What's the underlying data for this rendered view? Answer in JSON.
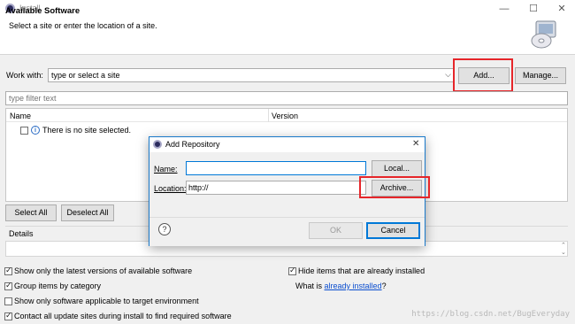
{
  "window": {
    "title": "Install",
    "minimize_glyph": "—",
    "maximize_glyph": "☐",
    "close_glyph": "✕"
  },
  "banner": {
    "title": "Available Software",
    "subtitle": "Select a site or enter the location of a site."
  },
  "work_with": {
    "label": "Work with:",
    "value": "type or select a site",
    "add_label": "Add...",
    "manage_label": "Manage..."
  },
  "filter": {
    "placeholder": "type filter text"
  },
  "tree": {
    "columns": [
      "Name",
      "Version"
    ],
    "message": "There is no site selected."
  },
  "selection": {
    "select_all": "Select All",
    "deselect_all": "Deselect All"
  },
  "details": {
    "label": "Details"
  },
  "options": {
    "latest_versions": "Show only the latest versions of available software",
    "group_by_category": "Group items by category",
    "target_env": "Show only software applicable to target environment",
    "contact_sites": "Contact all update sites during install to find required software",
    "hide_installed": "Hide items that are already installed",
    "what_is_prefix": "What is ",
    "what_is_link": "already installed",
    "what_is_suffix": "?"
  },
  "dialog": {
    "title": "Add Repository",
    "name_label": "Name:",
    "name_value": "",
    "location_label": "Location:",
    "location_value": "http://",
    "local_label": "Local...",
    "archive_label": "Archive...",
    "ok_label": "OK",
    "cancel_label": "Cancel",
    "help_glyph": "?"
  },
  "watermark": "https://blog.csdn.net/BugEveryday",
  "colors": {
    "highlight": "#e6262a",
    "dialog_border": "#1979ca",
    "link": "#0b4ecf"
  }
}
